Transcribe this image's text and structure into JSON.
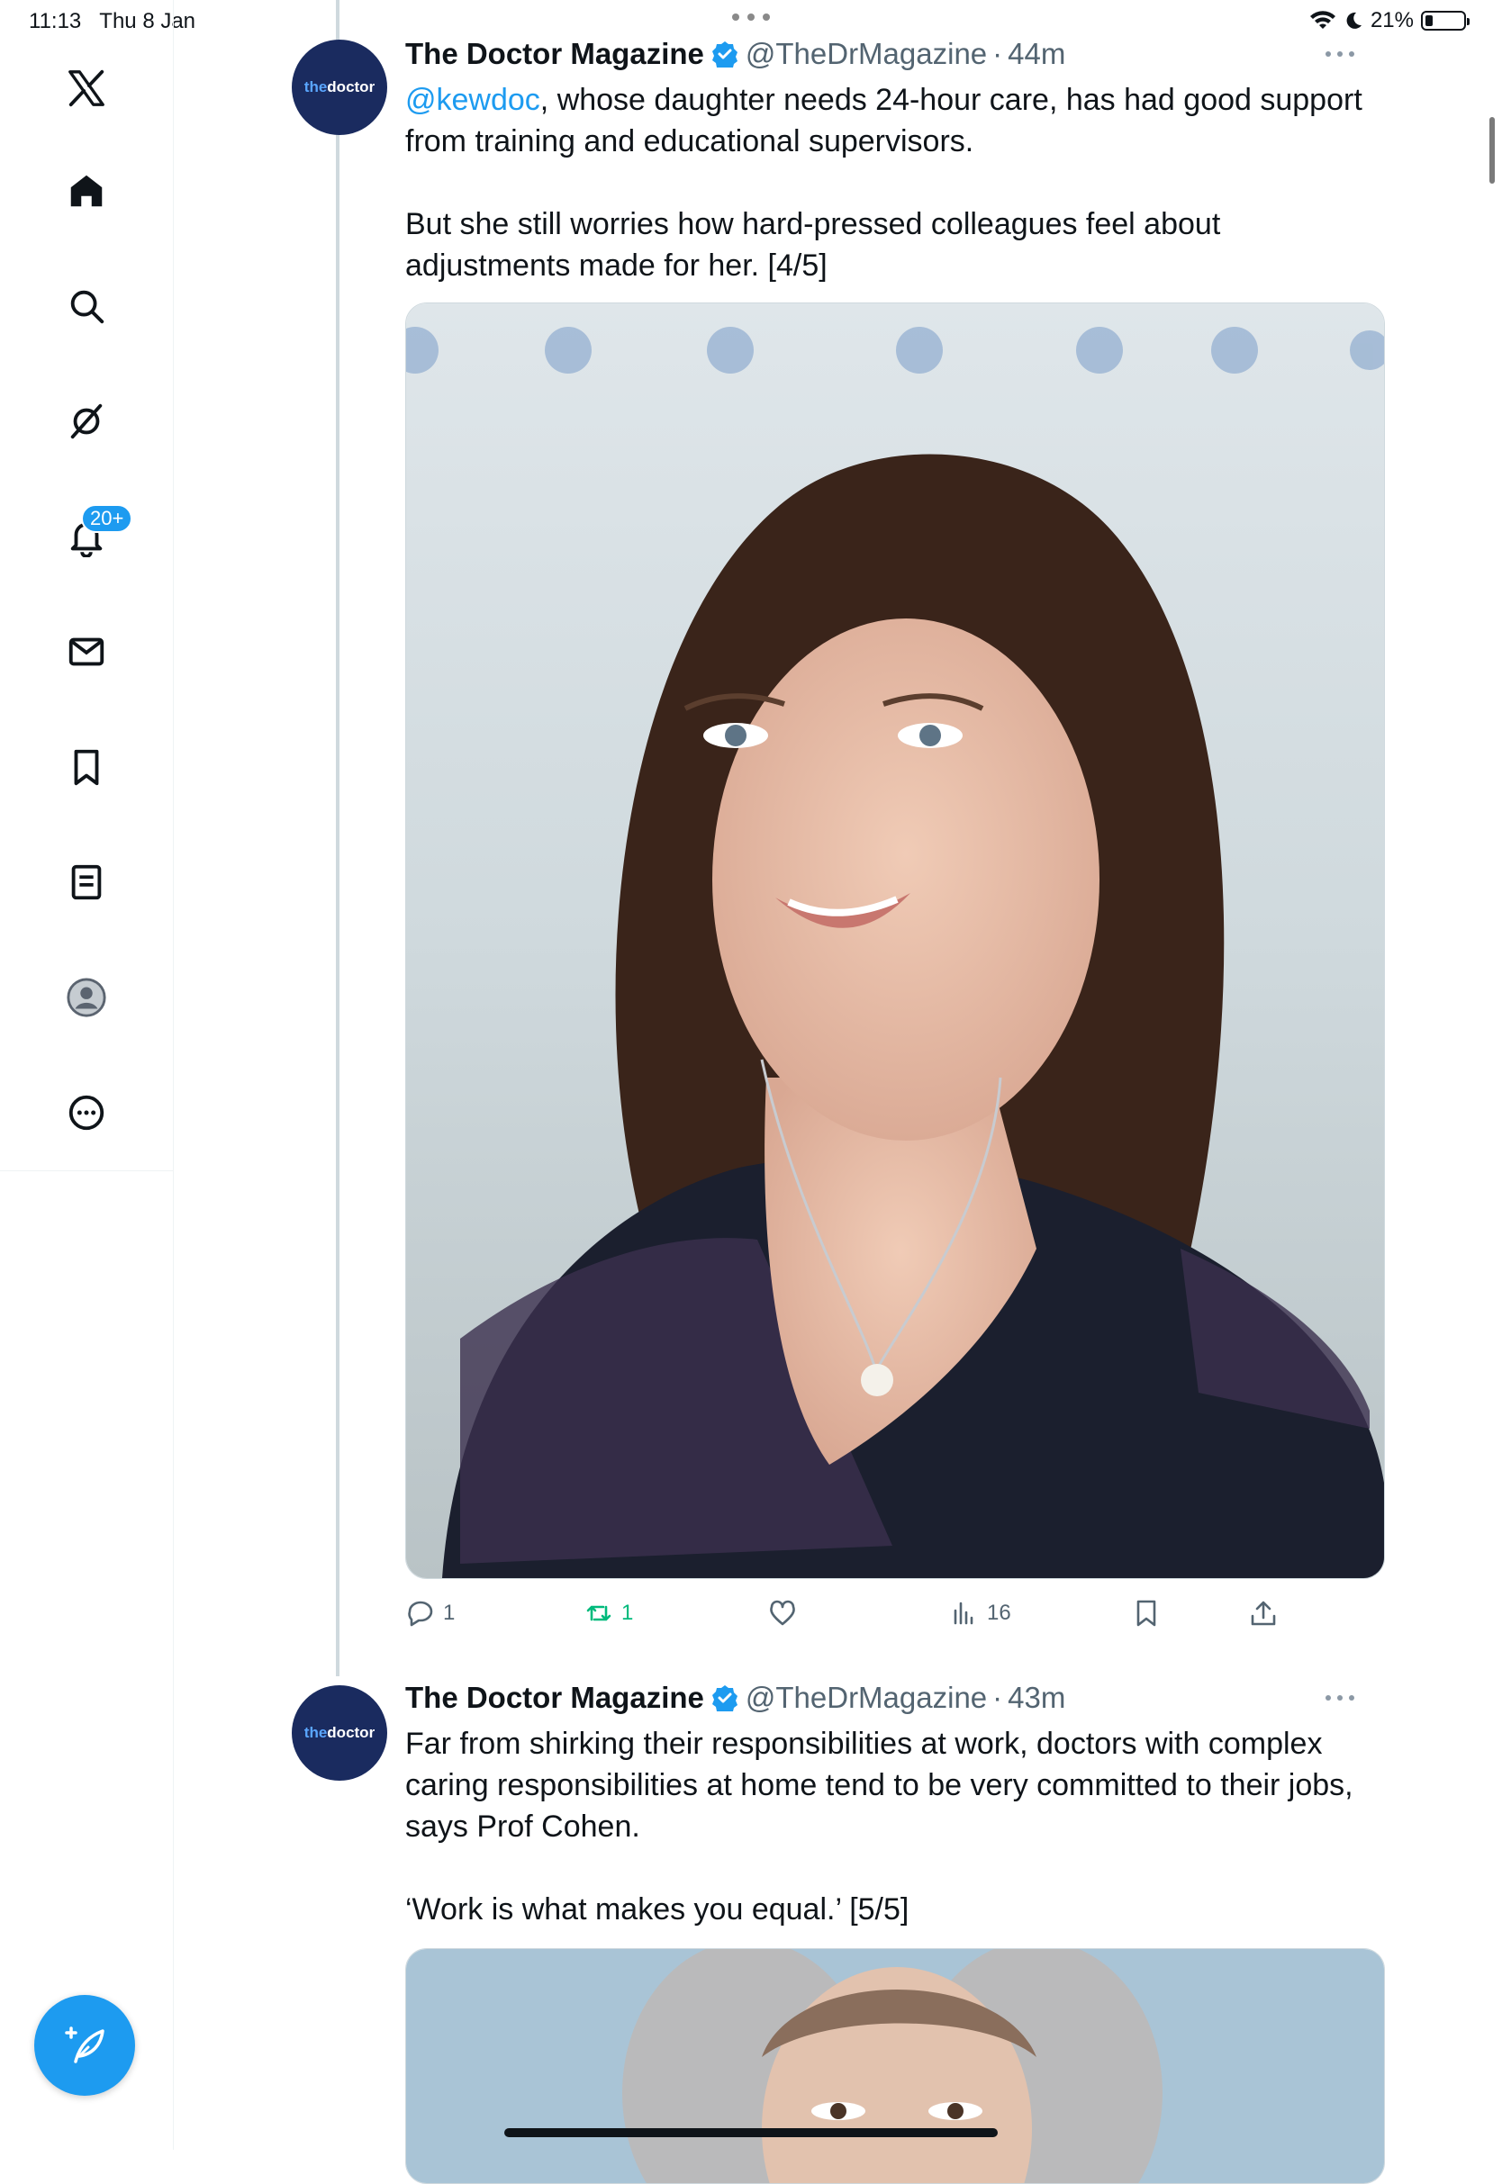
{
  "status_bar": {
    "time": "11:13",
    "date": "Thu 8 Jan",
    "battery": "21%",
    "battery_level": 0.21
  },
  "sidebar": {
    "logo_icon": "x-logo-icon",
    "items": [
      {
        "icon": "home-icon"
      },
      {
        "icon": "search-icon"
      },
      {
        "icon": "grok-icon"
      },
      {
        "icon": "notifications-icon",
        "badge": "20+"
      },
      {
        "icon": "messages-icon"
      },
      {
        "icon": "bookmarks-icon"
      },
      {
        "icon": "lists-icon"
      },
      {
        "icon": "profile-icon"
      },
      {
        "icon": "more-icon"
      }
    ],
    "compose_icon": "compose-post-icon"
  },
  "tweets": [
    {
      "avatar_text_a": "the",
      "avatar_text_b": "doctor",
      "name": "The Doctor Magazine",
      "handle": "@TheDrMagazine",
      "separator": "·",
      "time": "44m",
      "mention": "@kewdoc",
      "text_line1_rest": ", whose daughter needs 24-hour care, has had good support from training and educational supervisors.",
      "text_para2": "But she still worries how hard-pressed colleagues feel about adjustments made for her. [4/5]",
      "stats": {
        "replies": "1",
        "reposts": "1",
        "likes": "",
        "views": "16"
      }
    },
    {
      "avatar_text_a": "the",
      "avatar_text_b": "doctor",
      "name": "The Doctor Magazine",
      "handle": "@TheDrMagazine",
      "separator": "·",
      "time": "43m",
      "text_para1": "Far from shirking their responsibilities at work, doctors with complex caring responsibilities at home tend to be very committed to their jobs, says Prof Cohen.",
      "text_para2": "‘Work is what makes you equal.’ [5/5]"
    }
  ],
  "colors": {
    "accent": "#1d9bf0",
    "repost": "#00ba7c",
    "secondary_text": "#536471",
    "avatar_bg": "#1a2b5f"
  }
}
